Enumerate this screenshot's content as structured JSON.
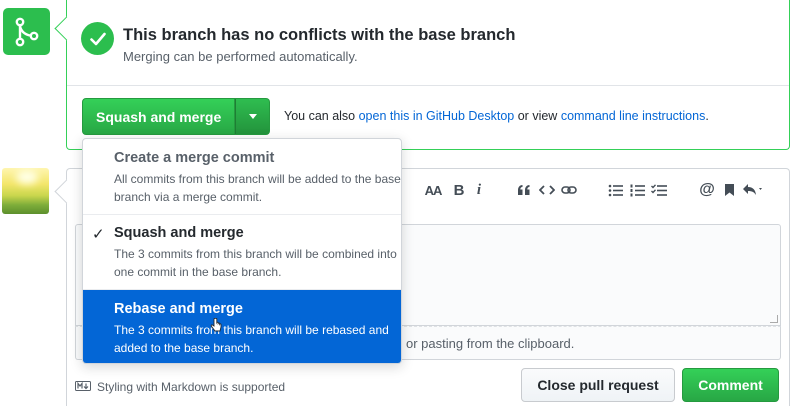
{
  "status": {
    "title": "This branch has no conflicts with the base branch",
    "subtitle": "Merging can be performed automatically."
  },
  "merge": {
    "button_label": "Squash and merge",
    "also_prefix": "You can also",
    "desktop_link": "open this in GitHub Desktop",
    "or_view": "or view",
    "cli_link": "command line instructions",
    "period": "."
  },
  "dropdown": {
    "options": [
      {
        "title": "Create a merge commit",
        "description": "All commits from this branch will be added to the base branch via a merge commit.",
        "selected": false,
        "highlighted": false
      },
      {
        "title": "Squash and merge",
        "description": "The 3 commits from this branch will be combined into one commit in the base branch.",
        "selected": true,
        "highlighted": false
      },
      {
        "title": "Rebase and merge",
        "description": "The 3 commits from this branch will be rebased and added to the base branch.",
        "selected": false,
        "highlighted": true
      }
    ]
  },
  "comment": {
    "attach_hint": "or pasting from the clipboard.",
    "markdown_note": "Styling with Markdown is supported",
    "close_button": "Close pull request",
    "comment_button": "Comment"
  },
  "toolbar": {
    "header_label": "AA",
    "bold_label": "B",
    "italic_label": "i"
  },
  "colors": {
    "green": "#2cbe4e",
    "link": "#0366d6",
    "highlight": "#0366d6"
  },
  "icons": [
    "git-merge-icon",
    "check-icon",
    "caret-down-icon",
    "quote-icon",
    "code-icon",
    "link-icon",
    "bullet-list-icon",
    "numbered-list-icon",
    "task-list-icon",
    "mention-icon",
    "bookmark-icon",
    "reply-icon",
    "markdown-icon",
    "checkmark-icon",
    "pointer-cursor-icon"
  ]
}
